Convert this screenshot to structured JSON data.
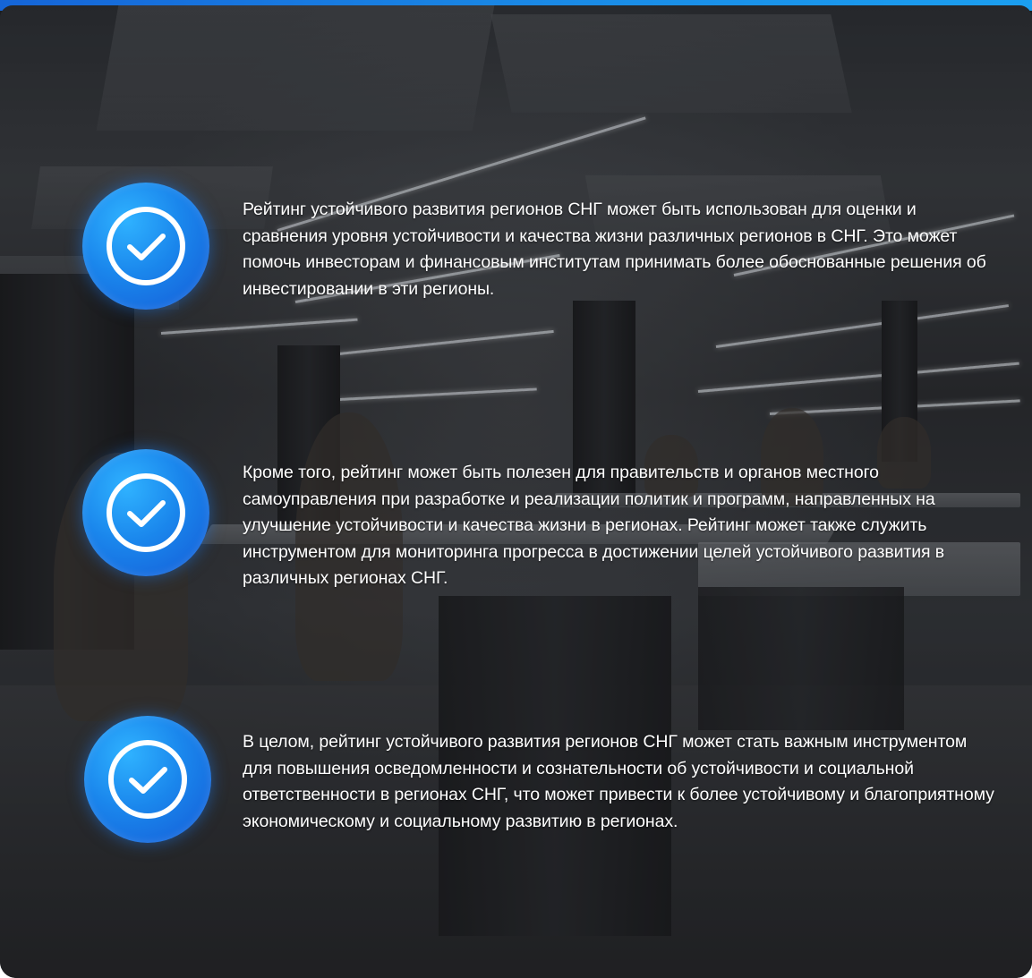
{
  "items": [
    {
      "icon": "check-circle-icon",
      "text": "Рейтинг устойчивого развития регионов СНГ может быть использован для оценки и сравнения уровня устойчивости и качества жизни различных регионов в СНГ. Это может помочь инвесторам и финансовым институтам принимать более обоснованные решения об инвестировании в эти регионы."
    },
    {
      "icon": "check-circle-icon",
      "text": "Кроме того, рейтинг может быть полезен для правительств и органов местного самоуправления при разработке и реализации политик и программ, направленных на улучшение устойчивости и качества жизни в регионах. Рейтинг может также служить инструментом для мониторинга прогресса в достижении целей устойчивого развития в различных регионах СНГ."
    },
    {
      "icon": "check-circle-icon",
      "text": "В целом, рейтинг устойчивого развития регионов СНГ может стать важным инструментом для повышения осведомленности и сознательности об устойчивости и социальной ответственности в регионах СНГ, что может привести к более устойчивому и благоприятному экономическому и социальному развитию в регионах."
    }
  ],
  "colors": {
    "accent": "#1a86ec",
    "accent_dark": "#1459d6",
    "text": "#ffffff"
  }
}
